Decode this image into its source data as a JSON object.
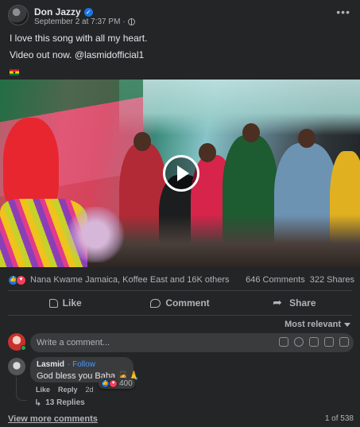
{
  "post": {
    "author": "Don Jazzy",
    "timestamp": "September 2 at 7:37 PM",
    "separator": "·",
    "more_label": "•••",
    "text_line1": "I love this song with all my heart.",
    "text_line2": "Video out now. @lasmidofficial1"
  },
  "reactions": {
    "summary": "Nana Kwame Jamaica, Koffee East and 16K others",
    "comments_count": "646 Comments",
    "shares_count": "322 Shares"
  },
  "actions": {
    "like": "Like",
    "comment": "Comment",
    "share": "Share"
  },
  "sort": {
    "label": "Most relevant"
  },
  "composer": {
    "placeholder": "Write a comment..."
  },
  "comment": {
    "name": "Lasmid",
    "follow": "· Follow",
    "text": "God bless you Baba 🙇🙏",
    "reaction_count": "400",
    "like": "Like",
    "reply": "Reply",
    "age": "2d",
    "replies": "13 Replies"
  },
  "footer": {
    "view_more": "View more comments",
    "page_count": "1 of 538"
  },
  "colors": {
    "background": "#242526",
    "accent": "#1b74e4",
    "love": "#f33e58",
    "link": "#4599ff"
  }
}
